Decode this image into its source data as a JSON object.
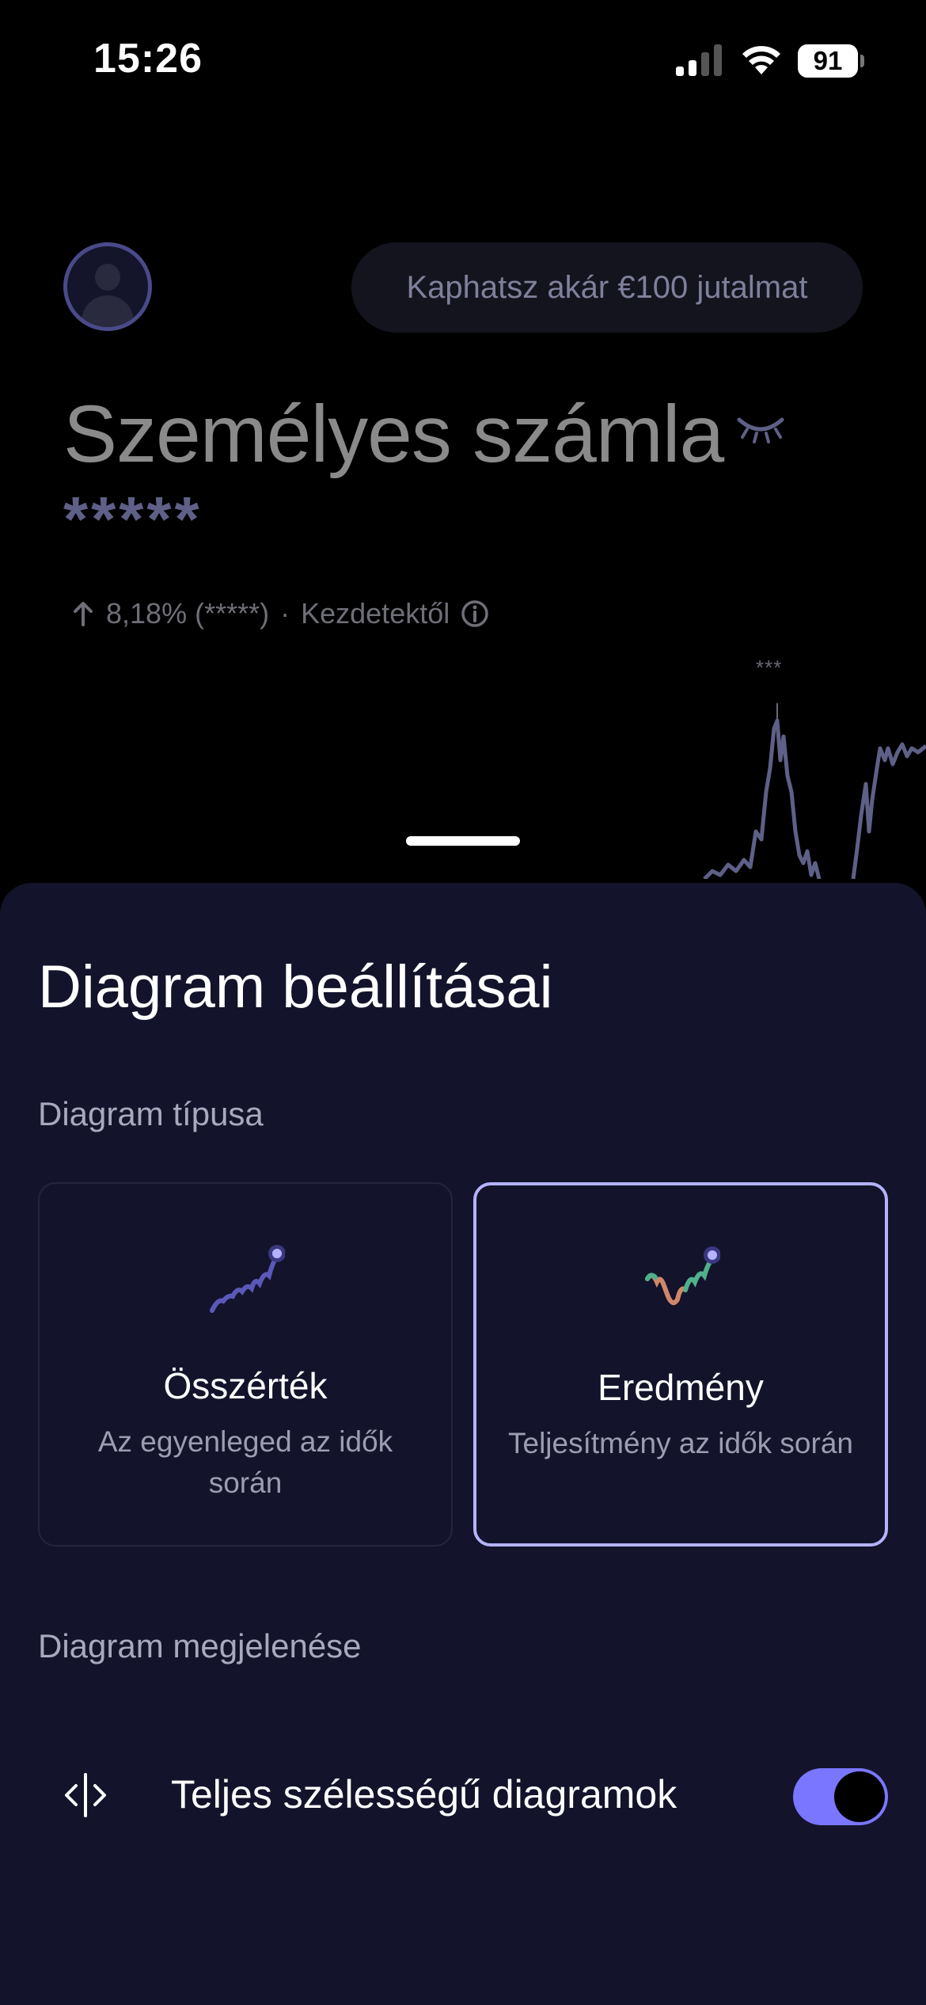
{
  "status_bar": {
    "time": "15:26",
    "battery": "91",
    "icons": [
      "cellular-signal-icon",
      "wifi-icon",
      "battery-icon"
    ]
  },
  "background": {
    "reward_pill": "Kaphatsz akár €100 jutalmat",
    "account_title": "Személyes számla",
    "balance_mask": "*****",
    "performance": {
      "change": "8,18% (*****)",
      "separator": "·",
      "period": "Kezdetektől"
    },
    "chart_peak_label": "***"
  },
  "sheet": {
    "title": "Diagram beállításai",
    "chart_type_label": "Diagram típusa",
    "cards": [
      {
        "title": "Összérték",
        "description": "Az egyenleged az idők során",
        "selected": false
      },
      {
        "title": "Eredmény",
        "description": "Teljesítmény az idők során",
        "selected": true
      }
    ],
    "appearance_label": "Diagram megjelenése",
    "full_width_setting": {
      "label": "Teljes szélességű diagramok",
      "enabled": true
    }
  },
  "colors": {
    "sheet_background": "#13132b",
    "accent": "#7a76ff",
    "selected_border": "#b5b3ff"
  }
}
